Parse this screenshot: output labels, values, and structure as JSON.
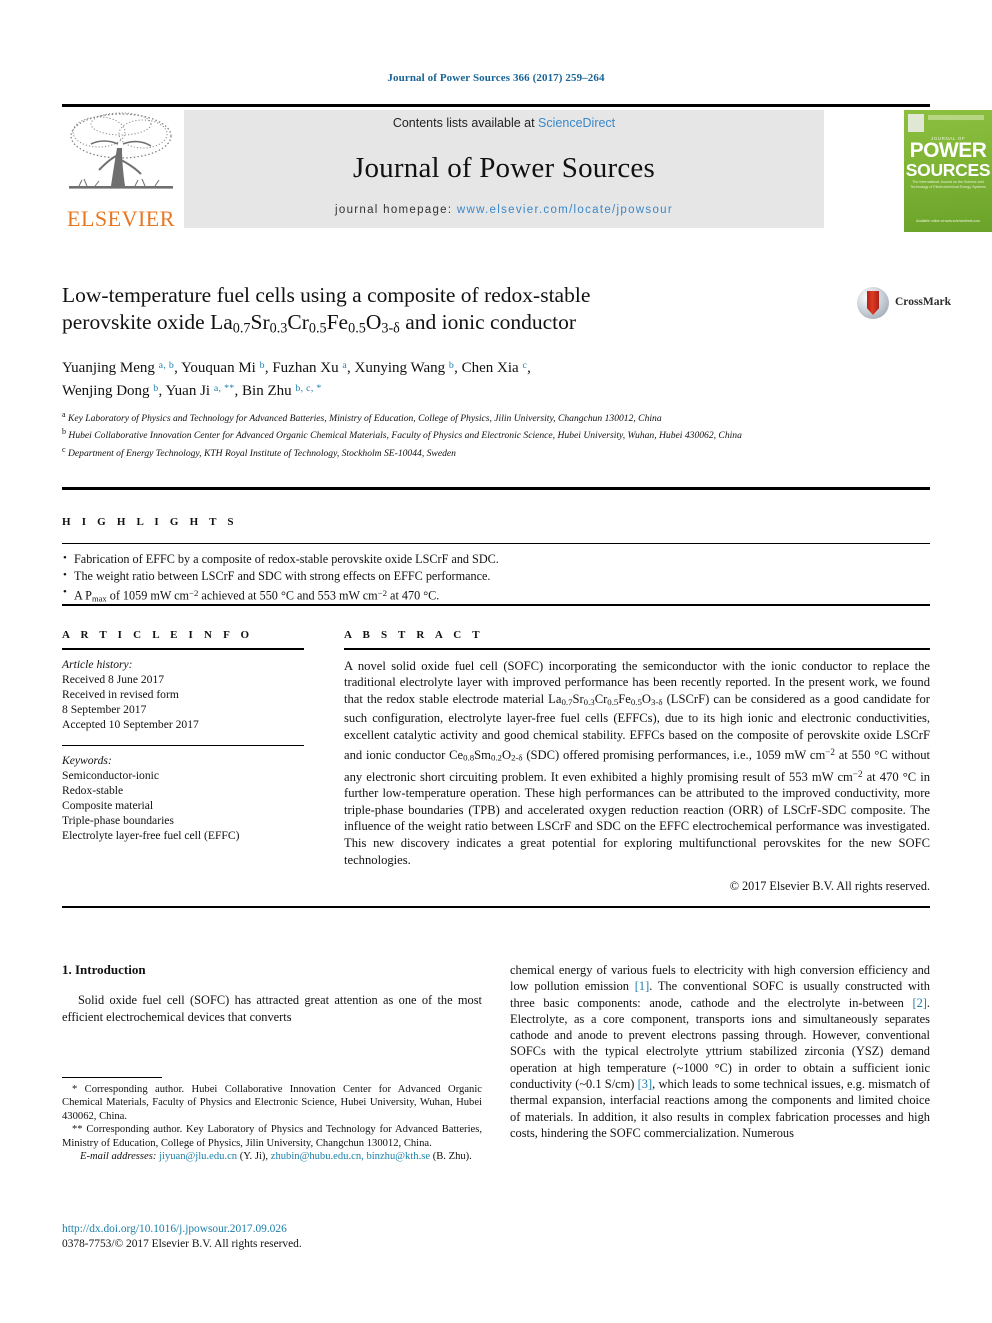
{
  "running_head": "Journal of Power Sources 366 (2017) 259–264",
  "masthead": {
    "contents_prefix": "Contents lists available at ",
    "sciencedirect": "ScienceDirect",
    "journal_title": "Journal of Power Sources",
    "homepage_label": "journal homepage: ",
    "homepage_url": "www.elsevier.com/locate/jpowsour",
    "publisher": "ELSEVIER",
    "cover": {
      "superline": "JOURNAL OF",
      "line1": "POWER",
      "line2": "SOURCES",
      "subline": "The International Journal on the Science and Technology of Electrochemical Energy Systems",
      "footline": "Available online at www.sciencedirect.com"
    },
    "accent_link_color": "#3a87c8",
    "elsevier_orange": "#E87722",
    "band_gray": "#e6e6e6"
  },
  "crossmark": {
    "label": "CrossMark"
  },
  "article": {
    "title_line1": "Low-temperature fuel cells using a composite of redox-stable",
    "title_line2_a": "perovskite oxide La",
    "title_sub_1": "0.7",
    "title_t2": "Sr",
    "title_sub_2": "0.3",
    "title_t3": "Cr",
    "title_sub_3": "0.5",
    "title_t4": "Fe",
    "title_sub_4": "0.5",
    "title_t5": "O",
    "title_sub_5": "3-δ",
    "title_tail": " and ionic conductor",
    "authors": [
      {
        "name": "Yuanjing Meng",
        "marks": "a, b",
        "sep": ", "
      },
      {
        "name": "Youquan Mi",
        "marks": "b",
        "sep": ", "
      },
      {
        "name": "Fuzhan Xu",
        "marks": "a",
        "sep": ", "
      },
      {
        "name": "Xunying Wang",
        "marks": "b",
        "sep": ", "
      },
      {
        "name": "Chen Xia",
        "marks": "c",
        "sep": ","
      },
      {
        "name": "Wenjing Dong",
        "marks": "b",
        "sep": ", "
      },
      {
        "name": "Yuan Ji",
        "marks": "a, **",
        "sep": ", "
      },
      {
        "name": "Bin Zhu",
        "marks": "b, c, *",
        "sep": ""
      }
    ],
    "affiliations": [
      {
        "mark": "a",
        "text": "Key Laboratory of Physics and Technology for Advanced Batteries, Ministry of Education, College of Physics, Jilin University, Changchun 130012, China"
      },
      {
        "mark": "b",
        "text": "Hubei Collaborative Innovation Center for Advanced Organic Chemical Materials, Faculty of Physics and Electronic Science, Hubei University, Wuhan, Hubei 430062, China"
      },
      {
        "mark": "c",
        "text": "Department of Energy Technology, KTH Royal Institute of Technology, Stockholm SE-10044, Sweden"
      }
    ]
  },
  "highlights": {
    "heading": "H I G H L I G H T S",
    "items_html": [
      "Fabrication of EFFC by a composite of redox-stable perovskite oxide LSCrF and SDC.",
      "The weight ratio between LSCrF and SDC with strong effects on EFFC performance.",
      "A P<sub>max</sub> of 1059 mW cm<sup>−2</sup> achieved at 550 °C and 553 mW cm<sup>−2</sup> at 470 °C."
    ]
  },
  "article_info": {
    "heading": "A R T I C L E   I N F O",
    "history_label": "Article history:",
    "history": [
      "Received 8 June 2017",
      "Received in revised form",
      "8 September 2017",
      "Accepted 10 September 2017"
    ],
    "keywords_label": "Keywords:",
    "keywords": [
      "Semiconductor-ionic",
      "Redox-stable",
      "Composite material",
      "Triple-phase boundaries",
      "Electrolyte layer-free fuel cell (EFFC)"
    ]
  },
  "abstract": {
    "heading": "A B S T R A C T",
    "body_html": "A novel solid oxide fuel cell (SOFC) incorporating the semiconductor with the ionic conductor to replace the traditional electrolyte layer with improved performance has been recently reported. In the present work, we found that the redox stable electrode material La<sub>0.7</sub>Sr<sub>0.3</sub>Cr<sub>0.5</sub>Fe<sub>0.5</sub>O<sub>3-δ</sub> (LSCrF) can be considered as a good candidate for such configuration, electrolyte layer-free fuel cells (EFFCs), due to its high ionic and electronic conductivities, excellent catalytic activity and good chemical stability. EFFCs based on the composite of perovskite oxide LSCrF and ionic conductor Ce<sub>0.8</sub>Sm<sub>0.2</sub>O<sub>2-δ</sub> (SDC) offered promising performances, i.e., 1059 mW cm<sup>−2</sup> at 550 °C without any electronic short circuiting problem. It even exhibited a highly promising result of 553 mW cm<sup>−2</sup> at 470 °C in further low-temperature operation. These high performances can be attributed to the improved conductivity, more triple-phase boundaries (TPB) and accelerated oxygen reduction reaction (ORR) of LSCrF-SDC composite. The influence of the weight ratio between LSCrF and SDC on the EFFC electrochemical performance was investigated. This new discovery indicates a great potential for exploring multifunctional perovskites for the new SOFC technologies.",
    "copyright": "© 2017 Elsevier B.V. All rights reserved."
  },
  "body": {
    "section_heading": "1. Introduction",
    "left_html": "Solid oxide fuel cell (SOFC) has attracted great attention as one of the most efficient electrochemical devices that converts",
    "right_html": "chemical energy of various fuels to electricity with high conversion efficiency and low pollution emission <span class=\"ref\">[1]</span>. The conventional SOFC is usually constructed with three basic components: anode, cathode and the electrolyte in-between <span class=\"ref\">[2]</span>. Electrolyte, as a core component, transports ions and simultaneously separates cathode and anode to prevent electrons passing through. However, conventional SOFCs with the typical electrolyte yttrium stabilized zirconia (YSZ) demand operation at high temperature (~1000 °C) in order to obtain a sufficient ionic conductivity (~0.1 S/cm) <span class=\"ref\">[3]</span>, which leads to some technical issues, e.g. mismatch of thermal expansion, interfacial reactions among the components and limited choice of materials. In addition, it also results in complex fabrication processes and high costs, hindering the SOFC commercialization. Numerous"
  },
  "footnotes": {
    "corresponding_1": "* Corresponding author. Hubei Collaborative Innovation Center for Advanced Organic Chemical Materials, Faculty of Physics and Electronic Science, Hubei University, Wuhan, Hubei 430062, China.",
    "corresponding_2": "** Corresponding author. Key Laboratory of Physics and Technology for Advanced Batteries, Ministry of Education, College of Physics, Jilin University, Changchun 130012, China.",
    "email_label": "E-mail addresses:",
    "email_1": "jiyuan@jlu.edu.cn",
    "email_1_owner": "(Y. Ji),",
    "email_2": "zhubin@hubu.edu.cn,",
    "email_3": "binzhu@kth.se",
    "email_3_owner": "(B. Zhu)."
  },
  "footer": {
    "doi": "http://dx.doi.org/10.1016/j.jpowsour.2017.09.026",
    "issn_line": "0378-7753/© 2017 Elsevier B.V. All rights reserved."
  }
}
